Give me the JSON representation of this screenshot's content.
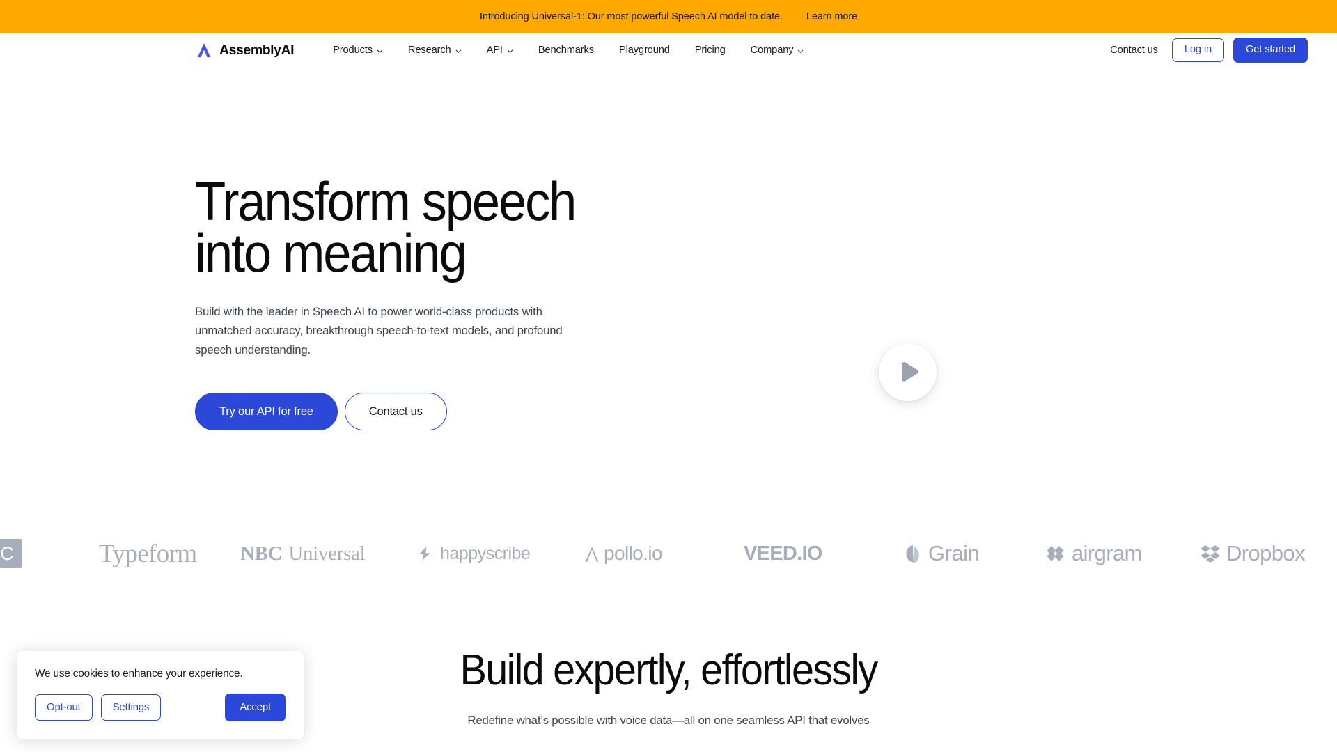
{
  "colors": {
    "banner_bg": "#FFA800",
    "brand_blue": "#2B48D8",
    "text_dark": "#0B0B0C",
    "text_muted": "#3C4653",
    "logo_gray": "#A7AEBB"
  },
  "announcement": {
    "text": "Introducing Universal-1: Our most powerful Speech AI model to date.",
    "link_label": "Learn more"
  },
  "nav": {
    "brand": "AssemblyAI",
    "items": [
      {
        "label": "Products",
        "has_caret": true
      },
      {
        "label": "Research",
        "has_caret": true
      },
      {
        "label": "API",
        "has_caret": true
      },
      {
        "label": "Benchmarks",
        "has_caret": false
      },
      {
        "label": "Playground",
        "has_caret": false
      },
      {
        "label": "Pricing",
        "has_caret": false
      },
      {
        "label": "Company",
        "has_caret": true
      }
    ],
    "contact_label": "Contact us",
    "login_label": "Log in",
    "get_started_label": "Get started"
  },
  "hero": {
    "title_line1": "Transform speech",
    "title_line2": "into meaning",
    "subtitle": "Build with the leader in Speech AI to power world-class products with unmatched accuracy, breakthrough speech-to-text models, and profound speech understanding.",
    "cta_primary": "Try our API for free",
    "cta_secondary": "Contact us",
    "play_button_label": "Play video"
  },
  "logo_strip": {
    "logos": [
      {
        "name": "CallRail",
        "display": "C"
      },
      {
        "name": "Typeform",
        "display": "Typeform"
      },
      {
        "name": "NBCUniversal",
        "display_bold": "NBC",
        "display_rest": "Universal"
      },
      {
        "name": "happyscribe",
        "display": "happyscribe"
      },
      {
        "name": "Apollo.io",
        "display": "pollo.io"
      },
      {
        "name": "VEED.IO",
        "display": "VEED.IO"
      },
      {
        "name": "Grain",
        "display": "Grain"
      },
      {
        "name": "airgram",
        "display": "airgram"
      },
      {
        "name": "Dropbox",
        "display": "Dropbox"
      }
    ]
  },
  "section_two": {
    "title": "Build expertly, effortlessly",
    "subtitle": "Redefine what’s possible with voice data—all on one seamless API that evolves"
  },
  "cookie_banner": {
    "message": "We use cookies to enhance your experience.",
    "opt_out_label": "Opt-out",
    "settings_label": "Settings",
    "accept_label": "Accept"
  }
}
